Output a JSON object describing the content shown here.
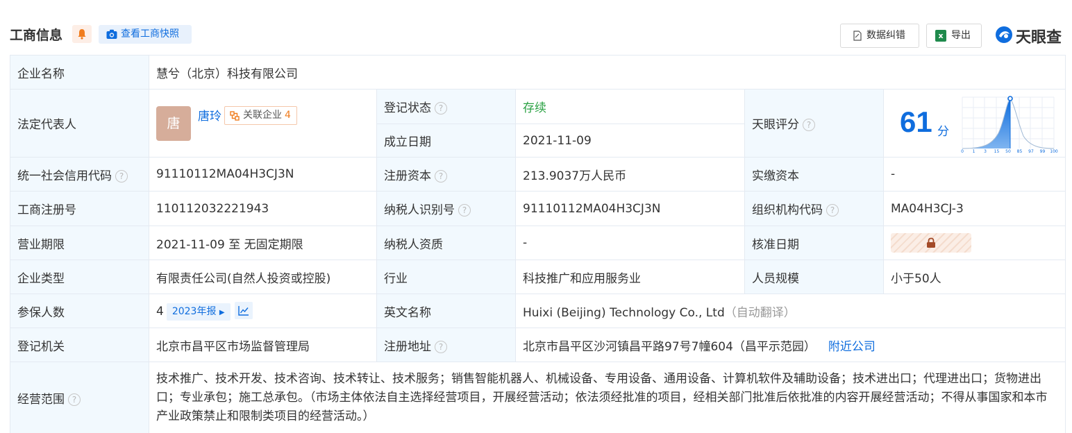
{
  "header": {
    "title": "工商信息",
    "snapshot_label": "查看工商快照",
    "correct_label": "数据纠错",
    "export_label": "导出",
    "logo_text": "天眼查"
  },
  "rows": {
    "company_name": {
      "label": "企业名称",
      "value": "慧兮（北京）科技有限公司"
    },
    "legal_rep": {
      "label": "法定代表人",
      "avatar_char": "唐",
      "name": "唐玲",
      "related_label": "关联企业",
      "related_count": "4"
    },
    "reg_status": {
      "label": "登记状态",
      "value": "存续"
    },
    "est_date": {
      "label": "成立日期",
      "value": "2021-11-09"
    },
    "tianyan_score": {
      "label": "天眼评分",
      "score": "61",
      "unit": "分",
      "axis_ticks": [
        "0",
        "1",
        "3",
        "15",
        "50",
        "85",
        "97",
        "99",
        "100"
      ]
    },
    "credit_code": {
      "label": "统一社会信用代码",
      "value": "91110112MA04H3CJ3N"
    },
    "reg_capital": {
      "label": "注册资本",
      "value": "213.9037万人民币"
    },
    "paid_capital": {
      "label": "实缴资本",
      "value": "-"
    },
    "reg_number": {
      "label": "工商注册号",
      "value": "110112032221943"
    },
    "taxpayer_id": {
      "label": "纳税人识别号",
      "value": "91110112MA04H3CJ3N"
    },
    "org_code": {
      "label": "组织机构代码",
      "value": "MA04H3CJ-3"
    },
    "biz_term": {
      "label": "营业期限",
      "value": "2021-11-09 至 无固定期限"
    },
    "taxpayer_qual": {
      "label": "纳税人资质",
      "value": "-"
    },
    "approval_date": {
      "label": "核准日期"
    },
    "company_type": {
      "label": "企业类型",
      "value": "有限责任公司(自然人投资或控股)"
    },
    "industry": {
      "label": "行业",
      "value": "科技推广和应用服务业"
    },
    "staff_size": {
      "label": "人员规模",
      "value": "小于50人"
    },
    "insured": {
      "label": "参保人数",
      "value": "4",
      "year_badge": "2023年报"
    },
    "english_name": {
      "label": "英文名称",
      "value": "Huixi (Beijing) Technology Co., Ltd",
      "note": "（自动翻译）"
    },
    "reg_authority": {
      "label": "登记机关",
      "value": "北京市昌平区市场监督管理局"
    },
    "reg_address": {
      "label": "注册地址",
      "value": "北京市昌平区沙河镇昌平路97号7幢604（昌平示范园）",
      "nearby_label": "附近公司"
    },
    "scope": {
      "label": "经营范围",
      "value": "技术推广、技术开发、技术咨询、技术转让、技术服务；销售智能机器人、机械设备、专用设备、通用设备、计算机软件及辅助设备；技术进出口；代理进出口；货物进出口；专业承包；施工总承包。（市场主体依法自主选择经营项目，开展经营活动；依法须经批准的项目，经相关部门批准后依批准的内容开展经营活动；不得从事国家和本市产业政策禁止和限制类项目的经营活动。）"
    }
  },
  "colors": {
    "accent": "#0f6dde",
    "status_green": "#2ba244",
    "label_bg": "#f2f9fe",
    "border": "#e4eaf2"
  }
}
